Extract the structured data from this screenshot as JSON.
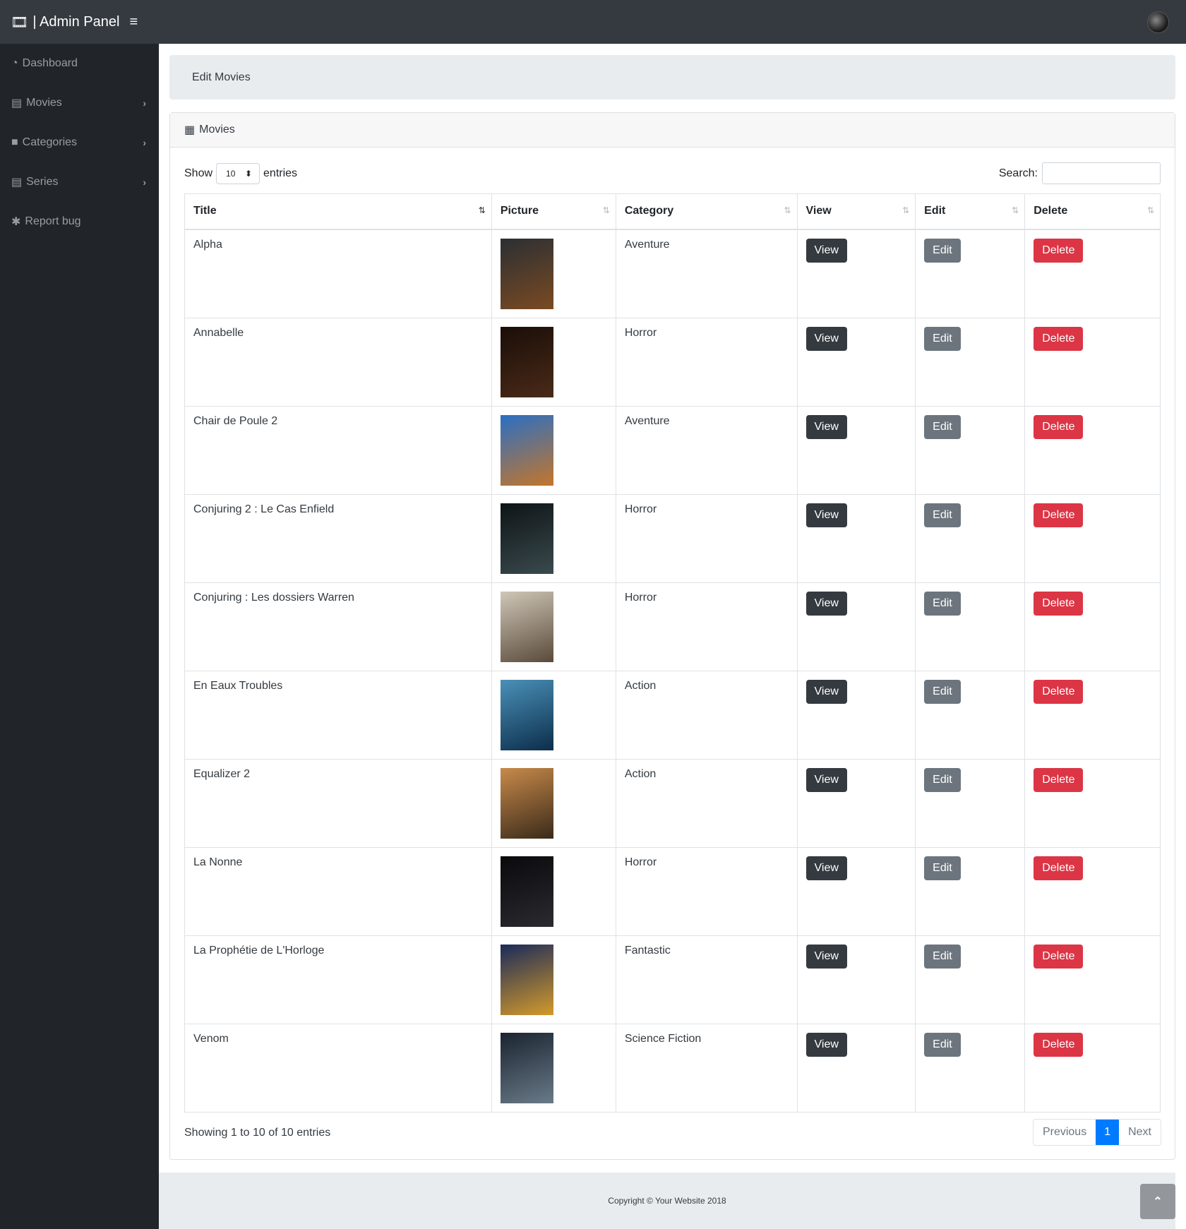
{
  "header": {
    "brand": "| Admin Panel"
  },
  "sidebar": {
    "items": [
      {
        "label": "Dashboard"
      },
      {
        "label": "Movies"
      },
      {
        "label": "Categories"
      },
      {
        "label": "Series"
      },
      {
        "label": "Report bug"
      }
    ]
  },
  "breadcrumb": "Edit Movies",
  "card": {
    "title": "Movies"
  },
  "controls": {
    "show": "Show",
    "entries_value": "10",
    "entries": "entries",
    "search_label": "Search:",
    "search_value": ""
  },
  "table": {
    "columns": [
      "Title",
      "Picture",
      "Category",
      "View",
      "Edit",
      "Delete"
    ],
    "rows": [
      {
        "title": "Alpha",
        "category": "Aventure",
        "poster": [
          "#2b2f33",
          "#7a4a22"
        ]
      },
      {
        "title": "Annabelle",
        "category": "Horror",
        "poster": [
          "#1a0e08",
          "#4a2a18"
        ]
      },
      {
        "title": "Chair de Poule 2",
        "category": "Aventure",
        "poster": [
          "#2a6fc4",
          "#c4762a"
        ]
      },
      {
        "title": "Conjuring 2 : Le Cas Enfield",
        "category": "Horror",
        "poster": [
          "#0e1416",
          "#3a4a4e"
        ]
      },
      {
        "title": "Conjuring : Les dossiers Warren",
        "category": "Horror",
        "poster": [
          "#cfc7b8",
          "#5a4a3a"
        ]
      },
      {
        "title": "En Eaux Troubles",
        "category": "Action",
        "poster": [
          "#4a90b8",
          "#0c2e4a"
        ]
      },
      {
        "title": "Equalizer 2",
        "category": "Action",
        "poster": [
          "#c88a4a",
          "#3a2a1a"
        ]
      },
      {
        "title": "La Nonne",
        "category": "Horror",
        "poster": [
          "#0a0a0c",
          "#2a2a30"
        ]
      },
      {
        "title": "La Prophétie de L'Horloge",
        "category": "Fantastic",
        "poster": [
          "#1a2a5a",
          "#d49a2a"
        ]
      },
      {
        "title": "Venom",
        "category": "Science Fiction",
        "poster": [
          "#1a2430",
          "#6a7a88"
        ]
      }
    ],
    "view_label": "View",
    "edit_label": "Edit",
    "delete_label": "Delete"
  },
  "info": "Showing 1 to 10 of 10 entries",
  "pagination": {
    "previous": "Previous",
    "current": "1",
    "next": "Next"
  },
  "footer": "Copyright © Your Website 2018"
}
